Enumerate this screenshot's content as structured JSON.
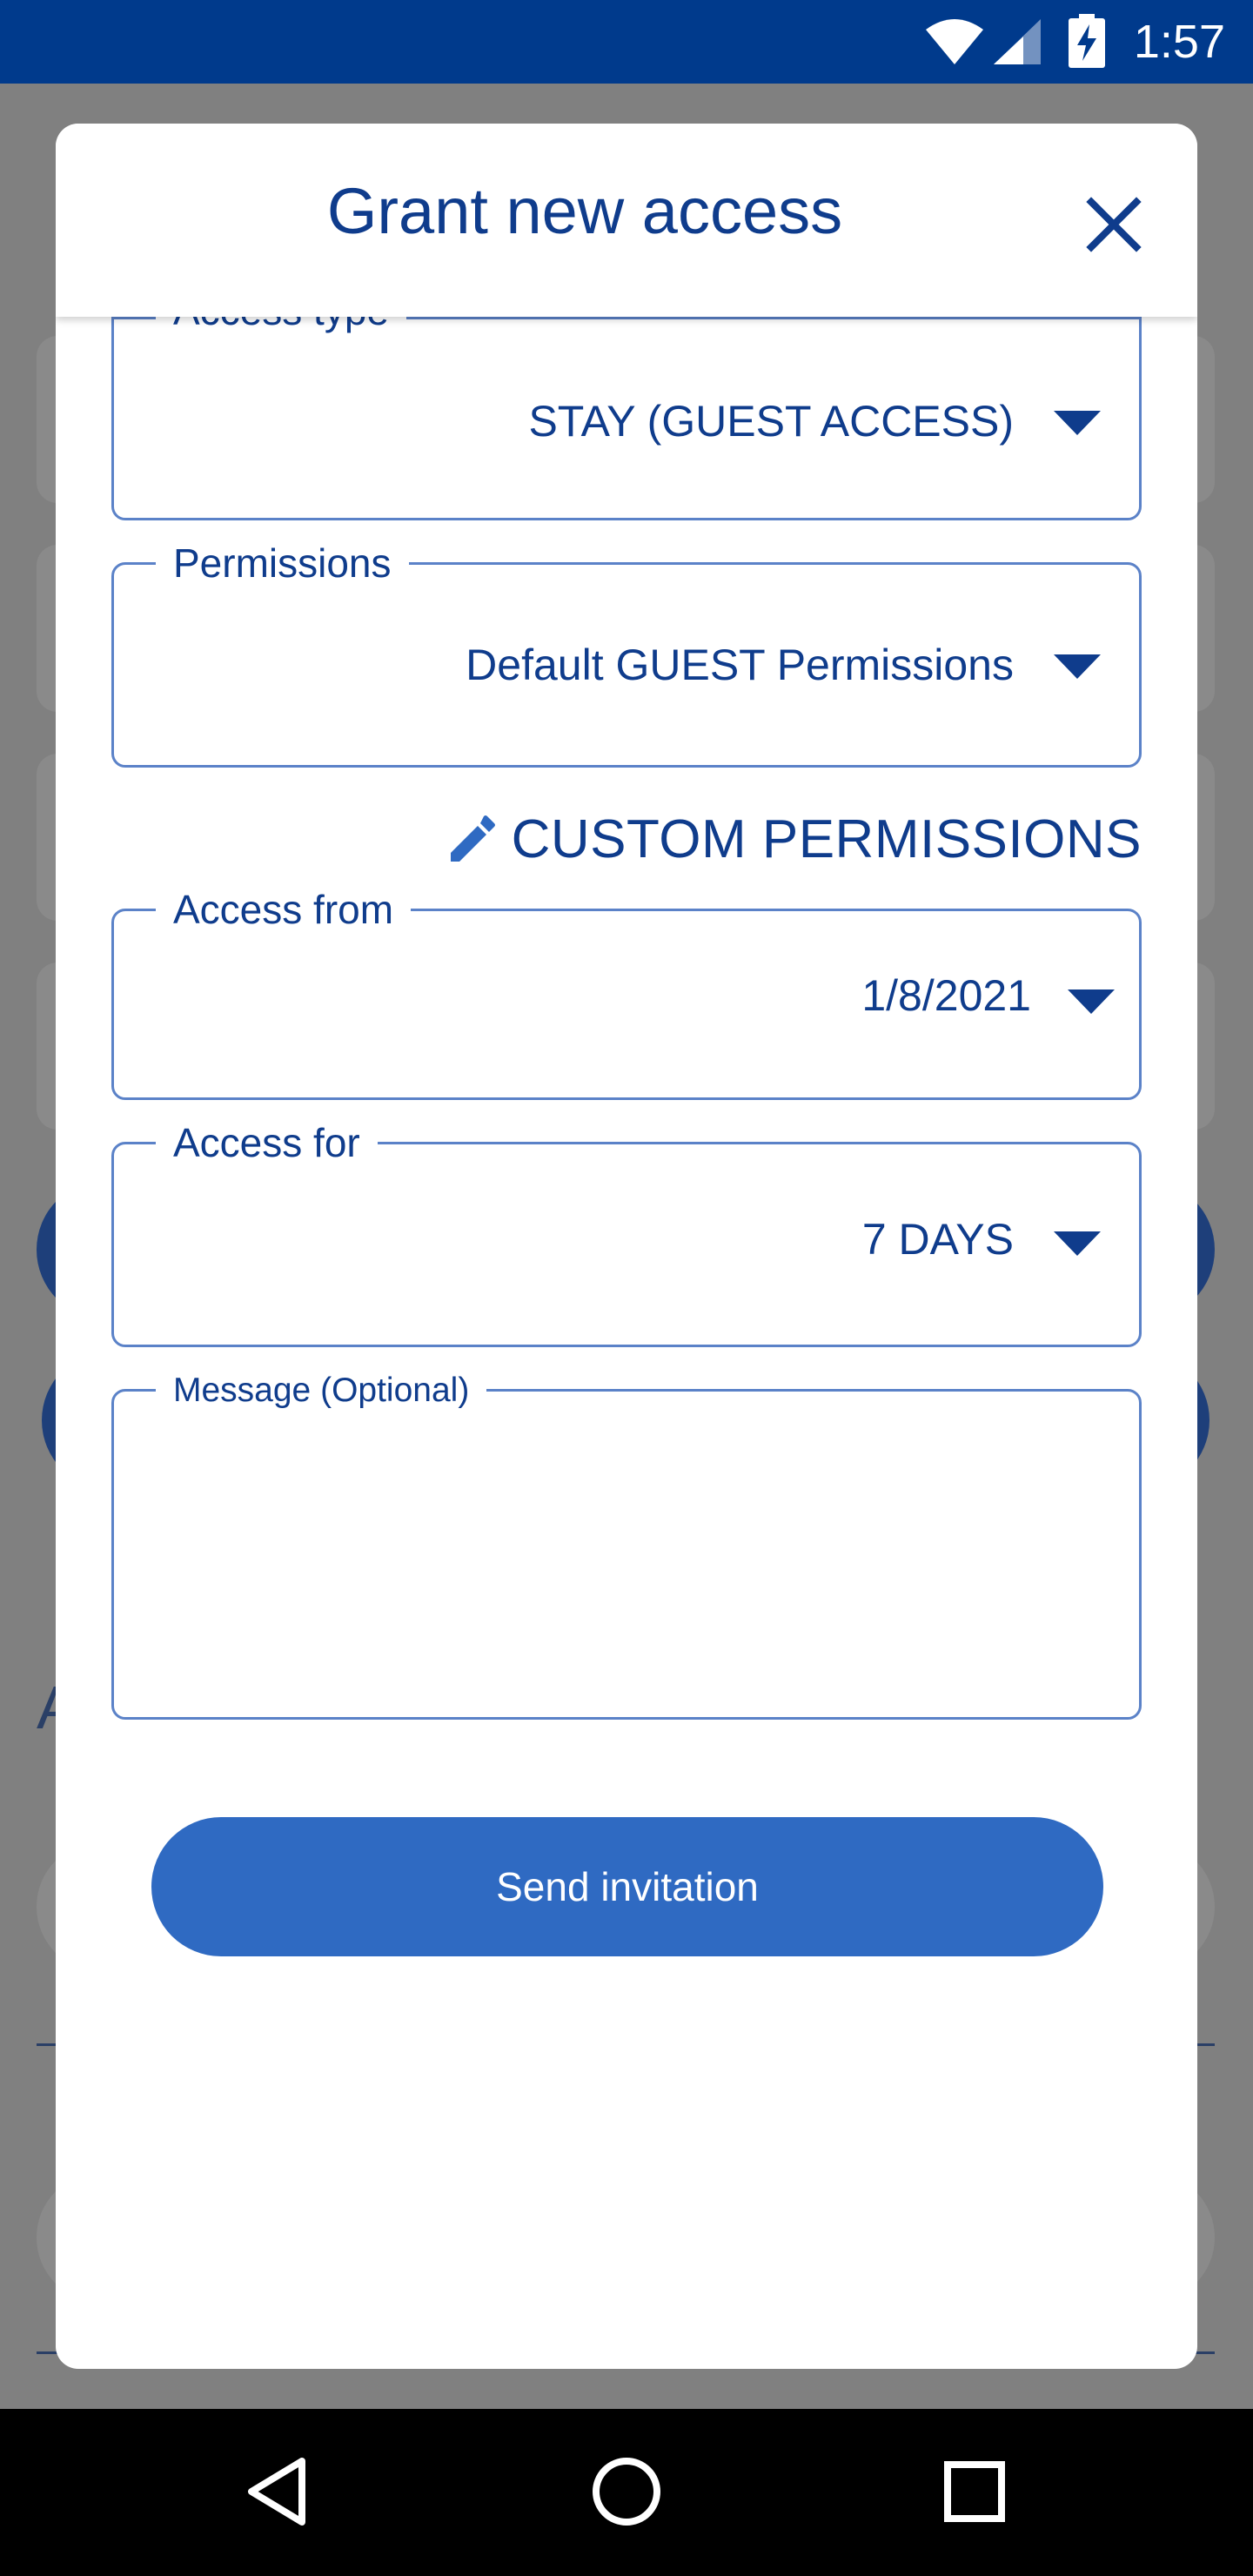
{
  "status_bar": {
    "time": "1:57",
    "icons": [
      "wifi-icon",
      "cell-signal-icon",
      "battery-charging-icon"
    ]
  },
  "dialog": {
    "title": "Grant new access",
    "close_icon": "close-icon",
    "access_type": {
      "label": "Access type",
      "value": "STAY (GUEST ACCESS)"
    },
    "permissions": {
      "label": "Permissions",
      "value": "Default GUEST Permissions"
    },
    "custom_permissions": {
      "label": "CUSTOM PERMISSIONS",
      "icon": "pencil-icon"
    },
    "access_from": {
      "label": "Access from",
      "value": "1/8/2021"
    },
    "access_for": {
      "label": "Access for",
      "value": "7 DAYS"
    },
    "message": {
      "label": "Message (Optional)",
      "value": ""
    },
    "send_button": "Send invitation"
  },
  "background": {
    "partial_letter": "A"
  },
  "nav_bar": {
    "buttons": [
      "back-icon",
      "home-icon",
      "recents-icon"
    ]
  },
  "colors": {
    "status_bar": "#003a8c",
    "primary_text": "#0f3c8c",
    "field_border": "#5b82c8",
    "button": "#2f6ac2",
    "scrim": "#808080"
  }
}
